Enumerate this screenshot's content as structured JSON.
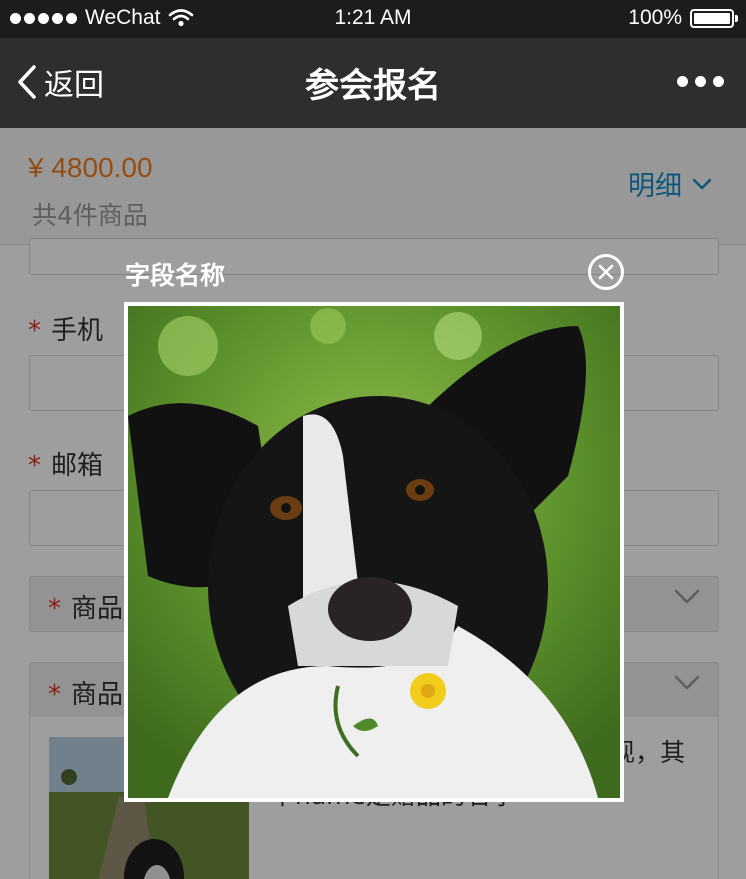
{
  "status_bar": {
    "carrier": "WeChat",
    "time": "1:21 AM",
    "battery": "100%"
  },
  "nav": {
    "back_label": "返回",
    "title": "参会报名"
  },
  "summary": {
    "price": "¥ 4800.00",
    "count": "共4件商品",
    "detail_label": "明细"
  },
  "form": {
    "required_mark": "*",
    "fields": [
      {
        "label": "手机"
      },
      {
        "label": "邮箱"
      }
    ],
    "selects": [
      {
        "label": "商品"
      },
      {
        "label": "商品"
      }
    ],
    "product": {
      "description": "类型，赠品会在extra数组中出现，其中name是赠品的名字"
    }
  },
  "modal": {
    "title": "字段名称"
  },
  "colors": {
    "accent_blue": "#1989c9",
    "price_orange": "#f07c1e",
    "required_red": "#e0331f"
  }
}
